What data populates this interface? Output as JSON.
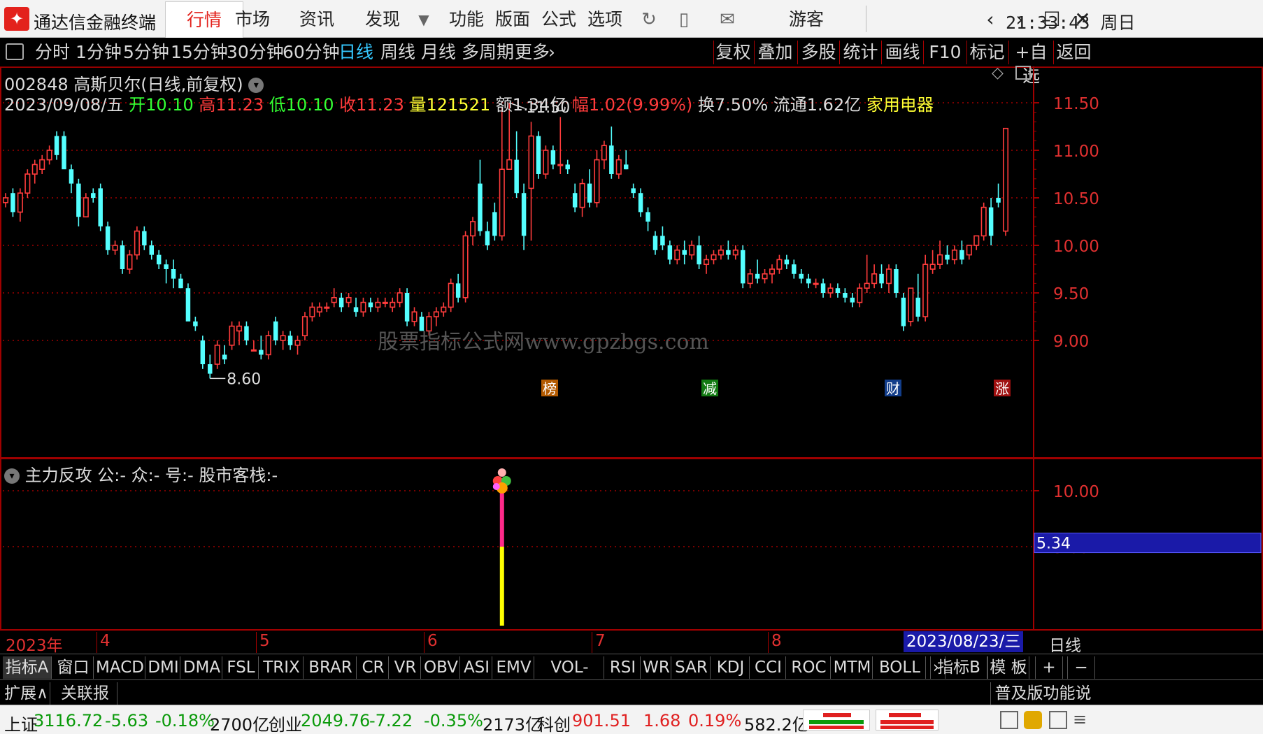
{
  "app": {
    "title": "通达信金融终端",
    "menu": [
      "行情",
      "市场",
      "资讯",
      "发现",
      "功能",
      "版面",
      "公式",
      "选项"
    ],
    "user": "游客",
    "clock": "21:33:43 周日"
  },
  "toolbar": {
    "periods": [
      "分时",
      "1分钟",
      "5分钟",
      "15分钟",
      "30分钟",
      "60分钟",
      "日线",
      "周线",
      "月线",
      "多周期",
      "更多"
    ],
    "selected": "日线",
    "right_buttons": [
      "复权",
      "叠加",
      "多股",
      "统计",
      "画线",
      "F10",
      "标记",
      "+自选",
      "返回"
    ]
  },
  "stock": {
    "code": "002848",
    "name": "高斯贝尔(日线,前复权)",
    "date": "2023/09/08/五",
    "open_label": "开",
    "open": "10.10",
    "high_label": "高",
    "high": "11.23",
    "low_label": "低",
    "low": "10.10",
    "close_label": "收",
    "close": "11.23",
    "vol_label": "量",
    "vol": "121521",
    "amount": "额1.34亿",
    "change_label": "幅",
    "change": "1.02(9.99%)",
    "turnover": "换7.50%",
    "float_cap": "流通1.62亿",
    "industry": "家用电器"
  },
  "watermark": "股票指标公式网www.gpzbgs.com",
  "chart_data": [
    {
      "type": "candlestick",
      "title": "002848 高斯贝尔(日线,前复权)",
      "ylim": [
        8.5,
        11.75
      ],
      "yticks": [
        9.0,
        9.5,
        10.0,
        10.5,
        11.0,
        11.5
      ],
      "annotations": {
        "max_label": "11.50",
        "min_label": "8.60"
      },
      "event_markers": [
        "榜",
        "减",
        "财",
        "涨"
      ],
      "candles": [
        [
          10.45,
          10.55,
          10.4,
          10.5
        ],
        [
          10.55,
          10.6,
          10.3,
          10.35
        ],
        [
          10.35,
          10.6,
          10.25,
          10.55
        ],
        [
          10.55,
          10.8,
          10.5,
          10.75
        ],
        [
          10.75,
          10.9,
          10.65,
          10.85
        ],
        [
          10.8,
          10.95,
          10.75,
          10.9
        ],
        [
          10.9,
          11.05,
          10.85,
          11.0
        ],
        [
          11.15,
          11.2,
          10.9,
          10.95
        ],
        [
          11.15,
          11.2,
          10.85,
          10.8
        ],
        [
          10.8,
          10.85,
          10.55,
          10.65
        ],
        [
          10.65,
          10.7,
          10.2,
          10.3
        ],
        [
          10.3,
          10.55,
          10.3,
          10.5
        ],
        [
          10.55,
          10.6,
          10.45,
          10.5
        ],
        [
          10.6,
          10.65,
          10.15,
          10.2
        ],
        [
          10.2,
          10.25,
          9.9,
          9.95
        ],
        [
          9.95,
          10.05,
          9.9,
          10.0
        ],
        [
          10.0,
          10.05,
          9.7,
          9.75
        ],
        [
          9.75,
          9.95,
          9.7,
          9.9
        ],
        [
          9.9,
          10.2,
          9.85,
          10.15
        ],
        [
          10.15,
          10.2,
          9.95,
          10.0
        ],
        [
          10.0,
          10.05,
          9.85,
          9.9
        ],
        [
          9.9,
          9.95,
          9.75,
          9.8
        ],
        [
          9.8,
          9.85,
          9.6,
          9.75
        ],
        [
          9.75,
          9.85,
          9.55,
          9.65
        ],
        [
          9.65,
          9.7,
          9.55,
          9.55
        ],
        [
          9.55,
          9.6,
          9.3,
          9.2
        ],
        [
          9.2,
          9.25,
          9.1,
          9.15
        ],
        [
          9.0,
          9.05,
          8.7,
          8.75
        ],
        [
          8.75,
          8.85,
          8.6,
          8.65
        ],
        [
          8.75,
          9.0,
          8.7,
          8.95
        ],
        [
          8.85,
          8.95,
          8.75,
          8.8
        ],
        [
          8.95,
          9.2,
          8.9,
          9.15
        ],
        [
          9.1,
          9.2,
          8.95,
          9.15
        ],
        [
          9.15,
          9.2,
          8.95,
          9.0
        ],
        [
          8.9,
          9.0,
          8.9,
          8.9
        ],
        [
          8.9,
          9.05,
          8.8,
          8.85
        ],
        [
          8.85,
          9.1,
          8.8,
          9.05
        ],
        [
          9.2,
          9.25,
          8.95,
          9.0
        ],
        [
          9.0,
          9.1,
          8.9,
          9.05
        ],
        [
          9.05,
          9.1,
          8.9,
          8.95
        ],
        [
          8.95,
          9.05,
          8.85,
          9.0
        ],
        [
          9.05,
          9.3,
          9.0,
          9.25
        ],
        [
          9.25,
          9.4,
          9.2,
          9.35
        ],
        [
          9.3,
          9.4,
          9.25,
          9.35
        ],
        [
          9.35,
          9.4,
          9.3,
          9.35
        ],
        [
          9.4,
          9.55,
          9.35,
          9.45
        ],
        [
          9.45,
          9.5,
          9.3,
          9.35
        ],
        [
          9.4,
          9.5,
          9.35,
          9.45
        ],
        [
          9.35,
          9.45,
          9.25,
          9.3
        ],
        [
          9.3,
          9.45,
          9.25,
          9.4
        ],
        [
          9.4,
          9.45,
          9.3,
          9.35
        ],
        [
          9.35,
          9.45,
          9.3,
          9.4
        ],
        [
          9.4,
          9.45,
          9.35,
          9.4
        ],
        [
          9.35,
          9.45,
          9.3,
          9.4
        ],
        [
          9.4,
          9.55,
          9.35,
          9.5
        ],
        [
          9.5,
          9.55,
          9.15,
          9.2
        ],
        [
          9.2,
          9.35,
          9.15,
          9.3
        ],
        [
          9.25,
          9.3,
          9.1,
          9.1
        ],
        [
          9.1,
          9.3,
          9.05,
          9.25
        ],
        [
          9.25,
          9.35,
          9.15,
          9.3
        ],
        [
          9.3,
          9.4,
          9.25,
          9.35
        ],
        [
          9.35,
          9.65,
          9.3,
          9.6
        ],
        [
          9.6,
          9.7,
          9.4,
          9.45
        ],
        [
          9.45,
          10.15,
          9.4,
          10.1
        ],
        [
          10.1,
          10.3,
          10.0,
          10.25
        ],
        [
          10.65,
          10.9,
          10.1,
          10.15
        ],
        [
          10.15,
          10.25,
          9.95,
          10.0
        ],
        [
          10.35,
          10.45,
          10.05,
          10.1
        ],
        [
          10.1,
          11.45,
          10.05,
          10.8
        ],
        [
          10.8,
          11.5,
          10.85,
          10.9
        ],
        [
          10.9,
          11.2,
          10.5,
          10.55
        ],
        [
          10.55,
          10.65,
          9.95,
          10.1
        ],
        [
          10.6,
          11.3,
          10.05,
          11.15
        ],
        [
          11.15,
          11.2,
          10.7,
          10.75
        ],
        [
          10.75,
          11.05,
          10.7,
          11.0
        ],
        [
          11.0,
          11.05,
          10.8,
          10.85
        ],
        [
          10.85,
          11.35,
          10.75,
          10.85
        ],
        [
          10.85,
          10.9,
          10.75,
          10.8
        ],
        [
          10.55,
          10.65,
          10.35,
          10.4
        ],
        [
          10.4,
          10.7,
          10.3,
          10.65
        ],
        [
          10.65,
          10.8,
          10.4,
          10.45
        ],
        [
          10.45,
          11.0,
          10.4,
          10.9
        ],
        [
          10.9,
          11.1,
          10.8,
          11.05
        ],
        [
          11.05,
          11.25,
          10.7,
          10.75
        ],
        [
          10.75,
          10.95,
          10.7,
          10.9
        ],
        [
          10.85,
          11.0,
          10.8,
          10.8
        ],
        [
          10.6,
          10.65,
          10.5,
          10.55
        ],
        [
          10.55,
          10.6,
          10.3,
          10.35
        ],
        [
          10.35,
          10.4,
          10.15,
          10.25
        ],
        [
          10.1,
          10.15,
          9.9,
          9.95
        ],
        [
          10.1,
          10.2,
          9.95,
          10.0
        ],
        [
          10.0,
          10.05,
          9.8,
          9.85
        ],
        [
          9.85,
          10.0,
          9.8,
          9.95
        ],
        [
          9.95,
          10.05,
          9.8,
          9.9
        ],
        [
          9.9,
          10.05,
          9.85,
          10.0
        ],
        [
          10.0,
          10.1,
          9.75,
          9.8
        ],
        [
          9.8,
          9.9,
          9.7,
          9.85
        ],
        [
          9.85,
          9.95,
          9.8,
          9.9
        ],
        [
          9.9,
          10.0,
          9.85,
          9.95
        ],
        [
          9.95,
          10.05,
          9.85,
          9.9
        ],
        [
          9.9,
          10.0,
          9.85,
          9.95
        ],
        [
          9.95,
          10.0,
          9.55,
          9.6
        ],
        [
          9.6,
          9.75,
          9.55,
          9.7
        ],
        [
          9.7,
          9.85,
          9.6,
          9.65
        ],
        [
          9.65,
          9.75,
          9.6,
          9.7
        ],
        [
          9.7,
          9.8,
          9.6,
          9.75
        ],
        [
          9.75,
          9.9,
          9.7,
          9.85
        ],
        [
          9.85,
          9.9,
          9.75,
          9.8
        ],
        [
          9.8,
          9.85,
          9.65,
          9.7
        ],
        [
          9.7,
          9.75,
          9.6,
          9.65
        ],
        [
          9.65,
          9.7,
          9.55,
          9.6
        ],
        [
          9.6,
          9.65,
          9.55,
          9.6
        ],
        [
          9.6,
          9.65,
          9.45,
          9.5
        ],
        [
          9.5,
          9.6,
          9.45,
          9.55
        ],
        [
          9.55,
          9.6,
          9.45,
          9.5
        ],
        [
          9.5,
          9.55,
          9.4,
          9.45
        ],
        [
          9.45,
          9.5,
          9.35,
          9.4
        ],
        [
          9.4,
          9.6,
          9.35,
          9.55
        ],
        [
          9.55,
          9.9,
          9.5,
          9.6
        ],
        [
          9.6,
          9.8,
          9.55,
          9.7
        ],
        [
          9.7,
          9.8,
          9.55,
          9.6
        ],
        [
          9.6,
          9.8,
          9.5,
          9.75
        ],
        [
          9.75,
          9.8,
          9.45,
          9.5
        ],
        [
          9.45,
          9.5,
          9.1,
          9.15
        ],
        [
          9.2,
          9.55,
          9.15,
          9.55
        ],
        [
          9.45,
          9.7,
          9.2,
          9.25
        ],
        [
          9.25,
          9.9,
          9.2,
          9.8
        ],
        [
          9.75,
          9.95,
          9.7,
          9.8
        ],
        [
          9.8,
          10.05,
          9.75,
          9.9
        ],
        [
          9.9,
          10.0,
          9.8,
          9.85
        ],
        [
          9.85,
          10.0,
          9.8,
          9.95
        ],
        [
          9.95,
          10.05,
          9.8,
          9.85
        ],
        [
          9.9,
          10.0,
          9.85,
          10.0
        ],
        [
          10.0,
          10.1,
          9.95,
          10.1
        ],
        [
          10.1,
          10.45,
          10.05,
          10.4
        ],
        [
          10.4,
          10.5,
          10.0,
          10.1
        ],
        [
          10.5,
          10.65,
          10.4,
          10.45
        ],
        [
          10.15,
          11.23,
          10.1,
          11.23
        ]
      ]
    },
    {
      "type": "bar",
      "title": "主力反攻",
      "ylim": [
        0,
        12.5
      ],
      "yticks": [
        5.0,
        10.0
      ],
      "current_value": "5.34",
      "signal_index": 68,
      "signal_value": 10.0
    }
  ],
  "sub_indicator": {
    "name": "主力反攻",
    "params": "公:- 众:- 号:- 股市客栈:-"
  },
  "axis": {
    "main_ticks": [
      "11.50",
      "11.00",
      "10.50",
      "10.00",
      "9.50",
      "9.00"
    ],
    "sub_ticks": [
      "10.00",
      "5.00"
    ],
    "current_value": "5.34"
  },
  "dates": {
    "year": "2023年",
    "months": [
      "4",
      "5",
      "6",
      "7",
      "8"
    ],
    "cursor_date": "2023/08/23/三",
    "period_label": "日线"
  },
  "indicators": [
    "指标A",
    "窗口",
    "MACD",
    "DMI",
    "DMA",
    "FSL",
    "TRIX",
    "BRAR",
    "CR",
    "VR",
    "OBV",
    "ASI",
    "EMV",
    "VOL-TDX",
    "RSI",
    "WR",
    "SAR",
    "KDJ",
    "CCI",
    "ROC",
    "MTM",
    "BOLL"
  ],
  "indicator_right": [
    "指标B",
    "模 板",
    "+",
    "−"
  ],
  "expand": {
    "left": "扩展∧",
    "link": "关联报价",
    "right": "普及版功能说明"
  },
  "status": {
    "sh_label": "上证",
    "sh_value": "3116.72",
    "sh_change": "-5.63",
    "sh_pct": "-0.18%",
    "sh_amount": "2700亿",
    "cy_label": "创业",
    "cy_value": "2049.76",
    "cy_change": "-7.22",
    "cy_pct": "-0.35%",
    "cy_amount": "2173亿",
    "kc_label": "科创",
    "kc_value": "901.51",
    "kc_change": "1.68",
    "kc_pct": "0.19%",
    "kc_amount": "582.2亿"
  },
  "colors": {
    "up": "#ff3c3c",
    "down": "#54ffff",
    "grid": "#a00000",
    "axis_text": "#e03030",
    "accent": "#e3221c"
  }
}
